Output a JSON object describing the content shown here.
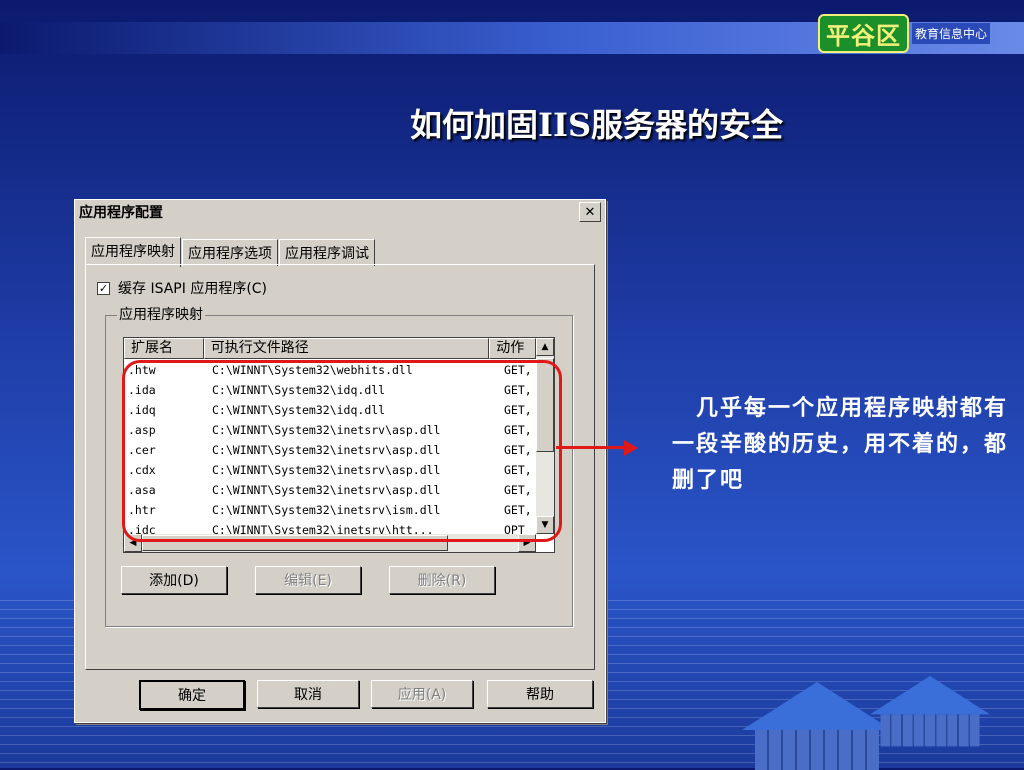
{
  "slide": {
    "logo_main": "平谷区",
    "logo_sub": "教育信息中心",
    "title": "如何加固IIS服务器的安全",
    "note": "　几乎每一个应用程序映射都有一段辛酸的历史，用不着的，都删了吧"
  },
  "dialog": {
    "title": "应用程序配置",
    "close_glyph": "✕",
    "tabs": [
      "应用程序映射",
      "应用程序选项",
      "应用程序调试"
    ],
    "checkbox_label": "缓存 ISAPI 应用程序(C)",
    "checkbox_checked": true,
    "checkbox_mark": "✓",
    "group_label": "应用程序映射",
    "columns": [
      "扩展名",
      "可执行文件路径",
      "动作"
    ],
    "rows": [
      {
        "ext": ".htw",
        "path": "C:\\WINNT\\System32\\webhits.dll",
        "verb": "GET,"
      },
      {
        "ext": ".ida",
        "path": "C:\\WINNT\\System32\\idq.dll",
        "verb": "GET,"
      },
      {
        "ext": ".idq",
        "path": "C:\\WINNT\\System32\\idq.dll",
        "verb": "GET,"
      },
      {
        "ext": ".asp",
        "path": "C:\\WINNT\\System32\\inetsrv\\asp.dll",
        "verb": "GET,"
      },
      {
        "ext": ".cer",
        "path": "C:\\WINNT\\System32\\inetsrv\\asp.dll",
        "verb": "GET,"
      },
      {
        "ext": ".cdx",
        "path": "C:\\WINNT\\System32\\inetsrv\\asp.dll",
        "verb": "GET,"
      },
      {
        "ext": ".asa",
        "path": "C:\\WINNT\\System32\\inetsrv\\asp.dll",
        "verb": "GET,"
      },
      {
        "ext": ".htr",
        "path": "C:\\WINNT\\System32\\inetsrv\\ism.dll",
        "verb": "GET,"
      },
      {
        "ext": ".idc",
        "path": "C:\\WINNT\\System32\\inetsrv\\htt...",
        "verb": "OPT"
      }
    ],
    "scroll_up": "▲",
    "scroll_down": "▼",
    "scroll_left": "◀",
    "scroll_right": "▶",
    "add_label": "添加(D)",
    "edit_label": "编辑(E)",
    "delete_label": "删除(R)",
    "ok_label": "确定",
    "cancel_label": "取消",
    "apply_label": "应用(A)",
    "help_label": "帮助"
  },
  "colors": {
    "highlight": "#e01818",
    "dialog_bg": "#d4d0c8",
    "slide_bg": "#1f3ea8"
  }
}
